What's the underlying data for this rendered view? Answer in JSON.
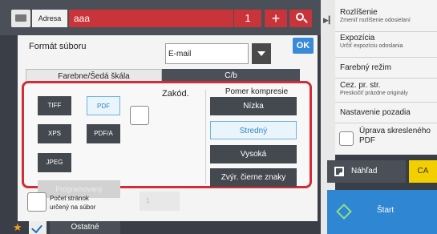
{
  "address_bar": {
    "label": "Adresa",
    "value": "aaa",
    "count": "1",
    "add_symbol": "+"
  },
  "panel": {
    "title": "Formát súboru",
    "ok_label": "OK",
    "format_select_value": "E-mail",
    "tabs": [
      {
        "label": "Farebne/Šedá škála",
        "selected": true
      },
      {
        "label": "C/b",
        "selected": false
      }
    ],
    "file_types": [
      {
        "label": "TIFF",
        "selected": false
      },
      {
        "label": "PDF",
        "selected": true
      },
      {
        "label": "XPS",
        "selected": false
      },
      {
        "label": "PDF/A",
        "selected": false
      },
      {
        "label": "JPEG",
        "selected": false
      }
    ],
    "programmed_label": "Programovaný",
    "encrypt_label": "Zakód.",
    "compression": {
      "title": "Pomer kompresie",
      "options": [
        {
          "label": "Nízka",
          "selected": false
        },
        {
          "label": "Stredný",
          "selected": true
        },
        {
          "label": "Vysoká",
          "selected": false
        },
        {
          "label": "Zvýr. čierne znaky",
          "selected": false
        }
      ]
    },
    "pages_per_file": {
      "label_line1": "Počet stránok",
      "label_line2": "určený na súbor",
      "value": "1"
    }
  },
  "bottom_bar": {
    "other_label": "Ostatné"
  },
  "right_menu": {
    "items": [
      {
        "title": "Rozlíšenie",
        "subtitle": "Zmeniť rozlíšenie odosielaní"
      },
      {
        "title": "Expozícia",
        "subtitle": "Určiť expozíciu odoslania"
      },
      {
        "title": "Farebný režim",
        "subtitle": ""
      },
      {
        "title": "Cez. pr. str.",
        "subtitle": "Preskočiť prázdne originály"
      },
      {
        "title": "Nastavenie pozadia",
        "subtitle": ""
      },
      {
        "title_line1": "Úprava skresleného",
        "title_line2": "PDF"
      }
    ],
    "preview_label": "Náhľad",
    "ca_label": "CA",
    "start_label": "Štart"
  },
  "colors": {
    "accent_red": "#c9343a",
    "highlight_frame": "#d22d37",
    "selected_blue": "#2f86c8",
    "start_blue": "#2f86d2",
    "ca_yellow": "#f3cf00",
    "dark_button": "#44484f"
  }
}
